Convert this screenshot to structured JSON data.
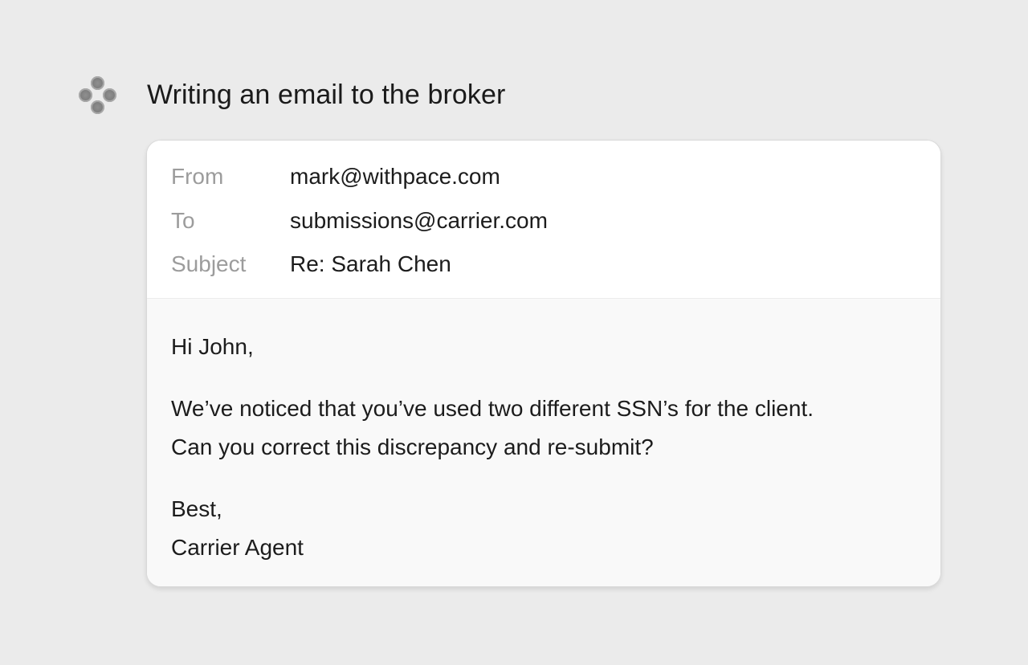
{
  "status": {
    "icon": "agent-dots-icon",
    "title": "Writing an email to the broker"
  },
  "email": {
    "from_label": "From",
    "from_value": "mark@withpace.com",
    "to_label": "To",
    "to_value": "submissions@carrier.com",
    "subject_label": "Subject",
    "subject_value": "Re: Sarah Chen",
    "greeting": "Hi John,",
    "body_line_1": "We’ve noticed that you’ve used two different SSN’s for the client.",
    "body_line_2": "Can you correct this discrepancy and re-submit?",
    "signoff": "Best,",
    "signature": "Carrier Agent"
  },
  "colors": {
    "background": "#ebebeb",
    "card": "#ffffff",
    "body_background": "#f9f9f9",
    "label_text": "#9c9c9c",
    "text": "#1c1c1c"
  }
}
